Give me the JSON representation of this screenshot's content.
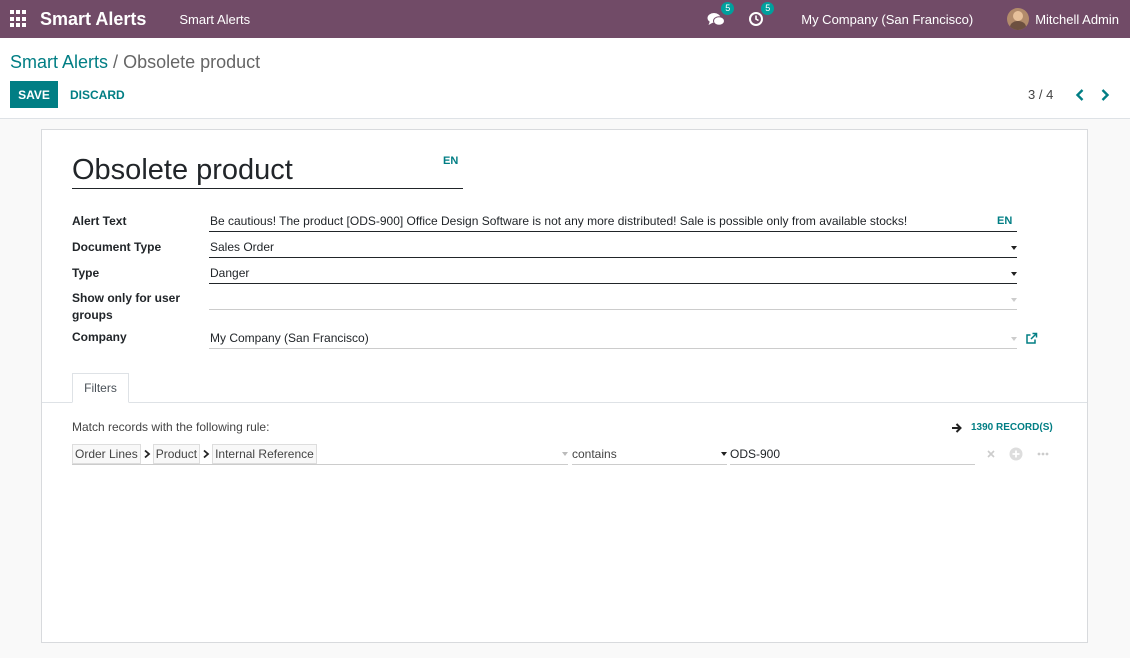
{
  "navbar": {
    "app_name": "Smart Alerts",
    "menu_item": "Smart Alerts",
    "messages_count": "5",
    "activities_count": "5",
    "company": "My Company (San Francisco)",
    "user": "Mitchell Admin"
  },
  "control_panel": {
    "breadcrumb_parent": "Smart Alerts",
    "breadcrumb_separator": "/",
    "breadcrumb_current": "Obsolete product",
    "save_label": "SAVE",
    "discard_label": "DISCARD",
    "pager": "3 / 4"
  },
  "form": {
    "name": "Obsolete product",
    "lang_tag": "EN",
    "fields": {
      "alert_text": {
        "label": "Alert Text",
        "value": "Be cautious! The product [ODS-900] Office Design Software is not any more distributed! Sale is possible only from available stocks!",
        "lang_tag": "EN"
      },
      "document_type": {
        "label": "Document Type",
        "value": "Sales Order"
      },
      "type": {
        "label": "Type",
        "value": "Danger"
      },
      "user_groups": {
        "label_line1": "Show only for user",
        "label_line2": "groups",
        "value": ""
      },
      "company": {
        "label": "Company",
        "value": "My Company (San Francisco)"
      }
    }
  },
  "tabs": [
    {
      "label": "Filters",
      "active": true
    }
  ],
  "filters": {
    "rule_label": "Match records with the following rule:",
    "record_count": "1390 RECORD(S)",
    "path": [
      "Order Lines",
      "Product",
      "Internal Reference"
    ],
    "operator": "contains",
    "value": "ODS-900"
  },
  "colors": {
    "navbar": "#714b67",
    "primary": "#017e84",
    "badge": "#00a09d"
  }
}
